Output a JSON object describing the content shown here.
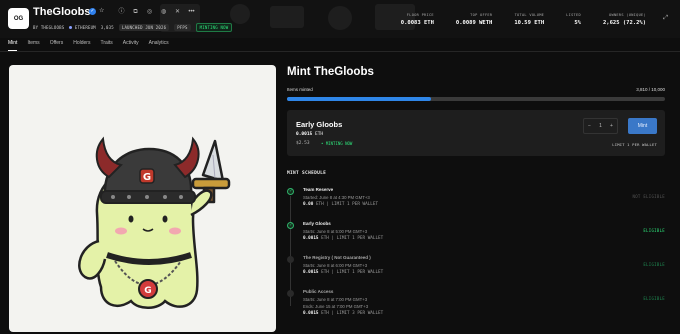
{
  "collection": {
    "logo_text": "OG",
    "title": "TheGloobs",
    "creator": "BY THEGLOOBS",
    "chain": "ETHEREUM",
    "items_count": "3,035",
    "launched": "LAUNCHED JUN 2026",
    "tag": "PFPS",
    "status": "MINTING NOW"
  },
  "stats": [
    {
      "label": "FLOOR PRICE",
      "value": "0.0083 ETH"
    },
    {
      "label": "TOP OFFER",
      "value": "0.0089 WETH"
    },
    {
      "label": "TOTAL VOLUME",
      "value": "10.59 ETH"
    },
    {
      "label": "LISTED",
      "value": "5%"
    },
    {
      "label": "OWNERS (UNIQUE)",
      "value": "2,625 (72.2%)"
    }
  ],
  "tabs": [
    "Mint",
    "Items",
    "Offers",
    "Holders",
    "Traits",
    "Activity",
    "Analytics"
  ],
  "mint": {
    "title": "Mint TheGloobs",
    "minted_label": "Items minted",
    "minted_value": "3,810 / 10,000",
    "progress": 0.381,
    "card": {
      "title": "Early Gloobs",
      "price": "0.0015",
      "price_unit": "ETH",
      "usd": "$2.53",
      "status": "• MINTING NOW",
      "qty_minus": "−",
      "qty": "1",
      "qty_plus": "+",
      "mint_label": "Mint",
      "limit": "LIMIT 1 PER WALLET"
    }
  },
  "schedule": {
    "header": "MINT SCHEDULE",
    "stages": [
      {
        "name": "Team Reserve",
        "line1": "Started: June 8 at 4:30 PM GMT+3",
        "price": "0.00",
        "line2": "ETH | LIMIT 1 PER WALLET",
        "status": "NOT ELIGIBLE",
        "state": "done"
      },
      {
        "name": "Early Gloobs",
        "line1": "Starts: June 8 at 5:00 PM GMT+3",
        "price": "0.0015",
        "line2": "ETH | LIMIT 1 PER WALLET",
        "status": "ELIGIBLE",
        "state": "done"
      },
      {
        "name": "The Registry ( Not Guaranteed )",
        "line1": "Starts: June 8 at 6:00 PM GMT+3",
        "price": "0.0015",
        "line2": "ETH | LIMIT 1 PER WALLET",
        "status": "ELIGIBLE",
        "state": "todo"
      },
      {
        "name": "Public Access",
        "line1": "Starts: June 8 at 7:00 PM GMT+3",
        "line1b": "Ends: June 15 at 7:00 PM GMT+3",
        "price": "0.0015",
        "line2": "ETH | LIMIT 3 PER WALLET",
        "status": "ELIGIBLE",
        "state": "todo"
      }
    ]
  },
  "colors": {
    "accent": "#2f86e8",
    "eligible": "#2ee27a",
    "background": "#0e0e0e"
  }
}
